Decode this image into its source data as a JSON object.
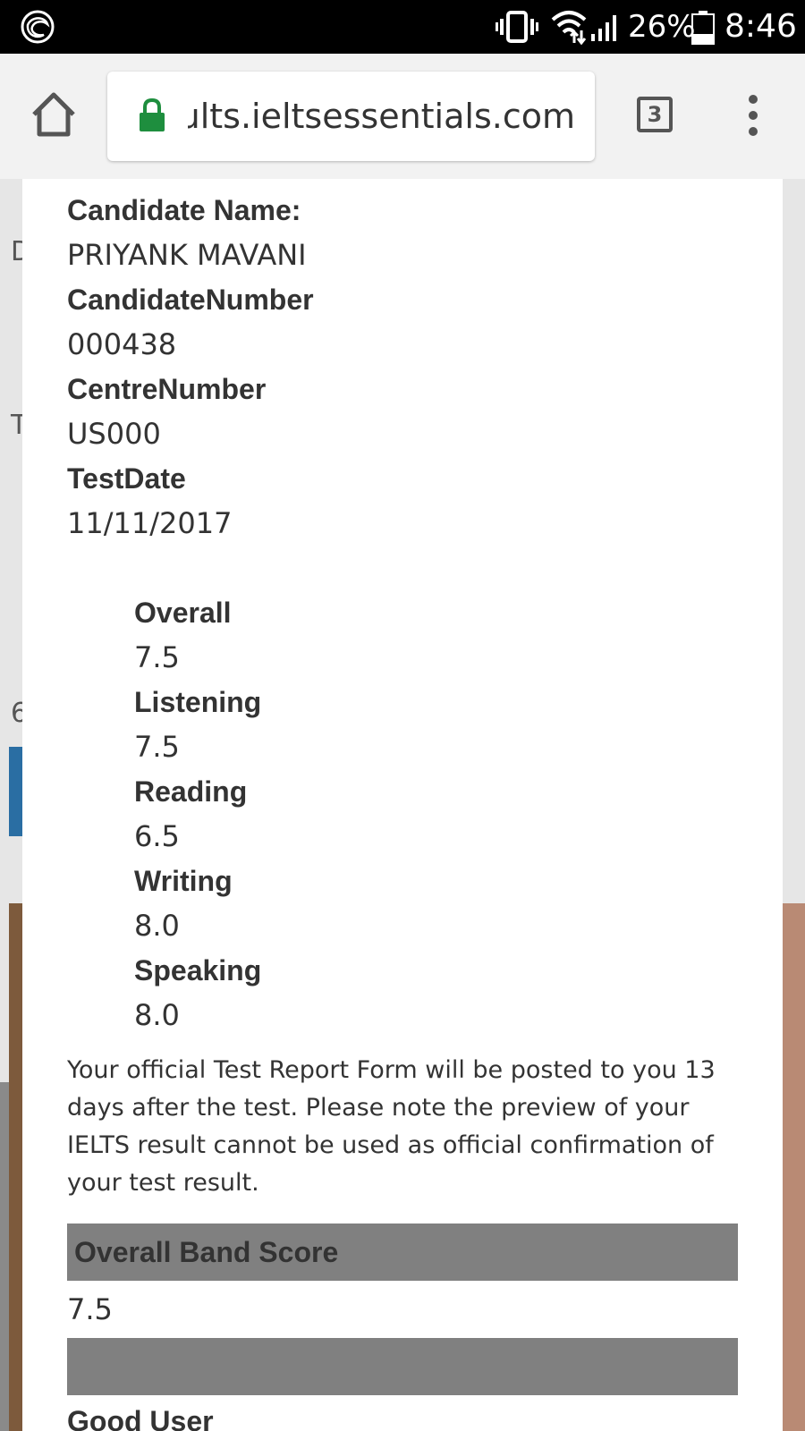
{
  "status_bar": {
    "battery_percent": "26%",
    "time": "8:46",
    "icons": [
      "notification-icon",
      "vibrate-icon",
      "wifi-icon",
      "signal-icon",
      "battery-icon"
    ]
  },
  "browser": {
    "url": "results.ieltsessentials.com",
    "tab_count": "3",
    "icons": [
      "home-icon",
      "lock-icon",
      "tabs-icon",
      "overflow-menu-icon"
    ],
    "lock_color": "#1e8e3e"
  },
  "background_page": {
    "fragments": [
      "D",
      "T",
      "6"
    ]
  },
  "candidate": {
    "name_label": "Candidate Name:",
    "name": "PRIYANK MAVANI",
    "number_label": "CandidateNumber",
    "number": "000438",
    "centre_label": "CentreNumber",
    "centre": "US000",
    "date_label": "TestDate",
    "date": "11/11/2017"
  },
  "scores": [
    {
      "label": "Overall",
      "value": "7.5"
    },
    {
      "label": "Listening",
      "value": "7.5"
    },
    {
      "label": "Reading",
      "value": "6.5"
    },
    {
      "label": "Writing",
      "value": "8.0"
    },
    {
      "label": "Speaking",
      "value": "8.0"
    }
  ],
  "note": "Your official Test Report Form will be posted to you 13 days after the test. Please note the preview of your IELTS result cannot be used as official confirmation of your test result.",
  "band": {
    "header": "Overall Band Score",
    "value": "7.5",
    "description": "Good User"
  },
  "colors": {
    "band_header_bg": "#808080",
    "text": "#333333"
  }
}
